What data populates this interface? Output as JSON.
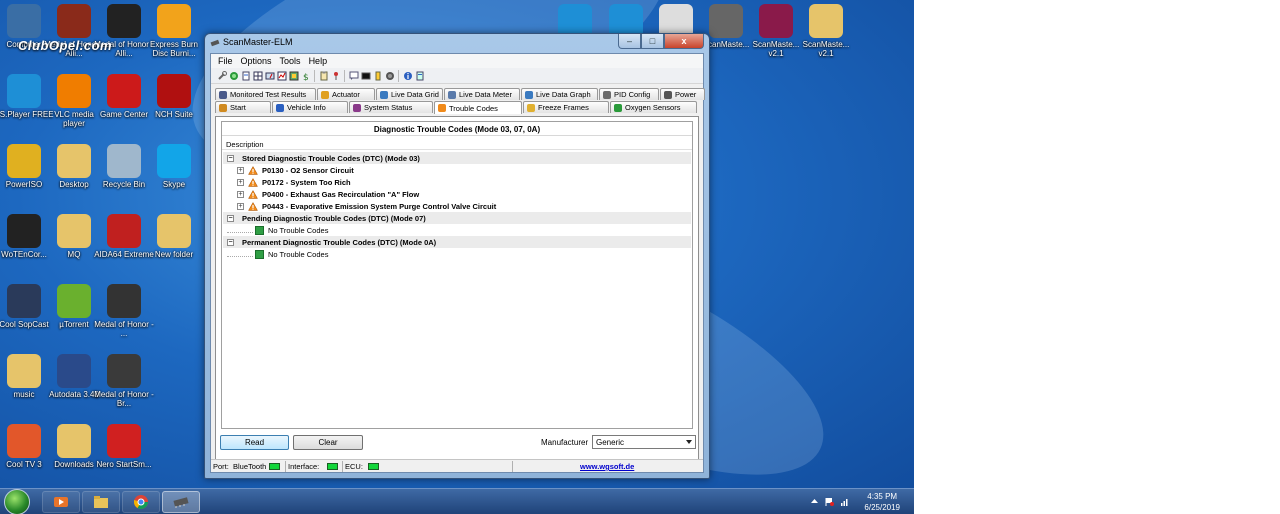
{
  "desktop": {
    "watermark": "ClubOpel.com",
    "icons": [
      {
        "label": "Computer",
        "color": "#3a6ea5"
      },
      {
        "label": "Medal of Honor - Alli...",
        "color": "#8a2a1a"
      },
      {
        "label": "Medal of Honor - Alli...",
        "color": "#222222"
      },
      {
        "label": "Express Burn Disc Burni...",
        "color": "#f2a31b"
      },
      {
        "label": "BS.Player FREE",
        "color": "#1e8fd6"
      },
      {
        "label": "VLC media player",
        "color": "#f07d00"
      },
      {
        "label": "Game Center",
        "color": "#cc1a1a"
      },
      {
        "label": "NCH Suite",
        "color": "#b01010"
      },
      {
        "label": "PowerISO",
        "color": "#e0b020"
      },
      {
        "label": "Desktop",
        "color": "#e6c46a"
      },
      {
        "label": "Recycle Bin",
        "color": "#9fb7cc"
      },
      {
        "label": "Skype",
        "color": "#12a5e8"
      },
      {
        "label": "WoTEnCor...",
        "color": "#222222"
      },
      {
        "label": "MQ",
        "color": "#e6c46a"
      },
      {
        "label": "AIDA64 Extreme",
        "color": "#c0201f"
      },
      {
        "label": "New folder",
        "color": "#e6c46a"
      },
      {
        "label": "Cool SopCast",
        "color": "#2a3a5a"
      },
      {
        "label": "µTorrent",
        "color": "#6ab02e"
      },
      {
        "label": "Medal of Honor - ...",
        "color": "#333333"
      },
      {
        "label": "music",
        "color": "#e6c46a"
      },
      {
        "label": "Autodata 3.40",
        "color": "#2a4a8a"
      },
      {
        "label": "Medal of Honor - Br...",
        "color": "#3a3a3a"
      },
      {
        "label": "Cool TV 3",
        "color": "#e2572a"
      },
      {
        "label": "Downloads",
        "color": "#e6c46a"
      },
      {
        "label": "Nero StartSm...",
        "color": "#d02020"
      },
      {
        "label": "",
        "color": "#1e8fd6"
      },
      {
        "label": "",
        "color": "#1e8fd6"
      },
      {
        "label": "",
        "color": "#dddddd"
      },
      {
        "label": "ScanMaste...",
        "color": "#666666"
      },
      {
        "label": "ScanMaste... v2.1",
        "color": "#8a1a4a"
      },
      {
        "label": "ScanMaste... v2.1",
        "color": "#e6c46a"
      }
    ]
  },
  "taskbar": {
    "clock_time": "4:35 PM",
    "clock_date": "6/25/2019"
  },
  "window": {
    "title": "ScanMaster-ELM",
    "min": "–",
    "max": "□",
    "close": "x",
    "menu": [
      "File",
      "Options",
      "Tools",
      "Help"
    ],
    "tabs_row1": [
      "Monitored Test Results",
      "Actuator",
      "Live Data Grid",
      "Live Data Meter",
      "Live Data Graph",
      "PID Config",
      "Power"
    ],
    "tabs_row2": [
      "Start",
      "Vehicle Info",
      "System Status",
      "Trouble Codes",
      "Freeze Frames",
      "Oxygen Sensors"
    ],
    "selected_tab": "Trouble Codes",
    "panel_title": "Diagnostic Trouble Codes (Mode 03, 07, 0A)",
    "column_header": "Description",
    "groups": [
      {
        "title": "Stored Diagnostic Trouble Codes (DTC) (Mode 03)",
        "items": [
          "P0130 - O2 Sensor Circuit",
          "P0172 - System Too Rich",
          "P0400 - Exhaust Gas Recirculation \"A\" Flow",
          "P0443 - Evaporative Emission System Purge Control Valve Circuit"
        ]
      },
      {
        "title": "Pending Diagnostic Trouble Codes (DTC) (Mode 07)",
        "items": [
          "No Trouble Codes"
        ]
      },
      {
        "title": "Permanent Diagnostic Trouble Codes (DTC) (Mode 0A)",
        "items": [
          "No Trouble Codes"
        ]
      }
    ],
    "read_label": "Read",
    "clear_label": "Clear",
    "manufacturer_label": "Manufacturer",
    "manufacturer_value": "Generic",
    "status": {
      "port_label": "Port:",
      "port_value": "BlueTooth",
      "interface_label": "Interface:",
      "ecu_label": "ECU:",
      "link": "www.wgsoft.de"
    }
  },
  "colors": {
    "warning": "#f08a1a",
    "led_green": "#12d63a",
    "link": "#0000cc"
  }
}
